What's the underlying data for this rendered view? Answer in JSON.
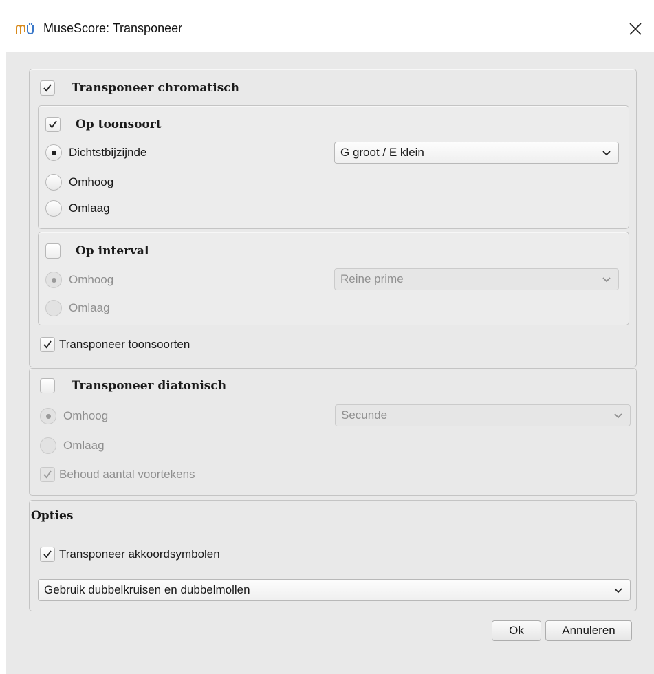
{
  "window": {
    "title": "MuseScore: Transponeer"
  },
  "chromatic": {
    "label": "Transponeer chromatisch",
    "checked": true,
    "by_key": {
      "label": "Op toonsoort",
      "options": [
        "Dichtstbijzijnde",
        "Omhoog",
        "Omlaag"
      ],
      "selected_option": "Dichtstbijzijnde",
      "key_select": "G groot / E klein"
    },
    "by_interval": {
      "label": "Op interval",
      "checked": false,
      "options": [
        "Omhoog",
        "Omlaag"
      ],
      "selected_option": "Omhoog",
      "interval_select": "Reine prime"
    },
    "transpose_keys_label": "Transponeer toonsoorten"
  },
  "diatonic": {
    "label": "Transponeer diatonisch",
    "checked": false,
    "options": [
      "Omhoog",
      "Omlaag"
    ],
    "selected_option": "Omhoog",
    "degree_select": "Secunde",
    "keep_accidentals_label": "Behoud aantal voortekens"
  },
  "options": {
    "title": "Opties",
    "chord_symbols_label": "Transponeer akkoordsymbolen",
    "accidentals_select": "Gebruik dubbelkruisen en dubbelmollen"
  },
  "buttons": {
    "ok": "Ok",
    "cancel": "Annuleren"
  },
  "icons": {
    "app": "musescore-icon",
    "close": "close-icon",
    "check": "checkmark-icon",
    "chevron": "chevron-down-icon"
  }
}
